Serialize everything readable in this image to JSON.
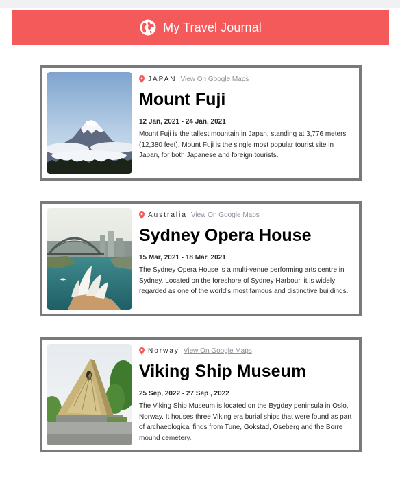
{
  "header": {
    "title": "My Travel Journal",
    "icon": "globe-icon",
    "color": "#F55A5A"
  },
  "entries": [
    {
      "country": "JAPAN",
      "map_link": "View On Google Maps",
      "place": "Mount Fuji",
      "dates": "12 Jan, 2021 - 24 Jan, 2021",
      "description": "Mount Fuji is the tallest mountain in Japan, standing at 3,776 meters (12,380 feet). Mount Fuji is the single most popular tourist site in Japan, for both Japanese and foreign tourists."
    },
    {
      "country": "Australia",
      "map_link": "View On Google Maps",
      "place": "Sydney Opera House",
      "dates": "15 Mar, 2021 - 18 Mar, 2021",
      "description": "The Sydney Opera House is a multi-venue performing arts centre in Sydney. Located on the foreshore of Sydney Harbour, it is widely regarded as one of the world's most famous and distinctive buildings."
    },
    {
      "country": "Norway",
      "map_link": "View On Google Maps",
      "place": "Viking Ship Museum",
      "dates": "25 Sep, 2022 - 27 Sep , 2022",
      "description": "The Viking Ship Museum is located on the Bygdøy peninsula in Oslo, Norway. It houses three Viking era burial ships that were found as part of archaeological finds from Tune, Gokstad, Oseberg and the Borre mound cemetery."
    }
  ]
}
